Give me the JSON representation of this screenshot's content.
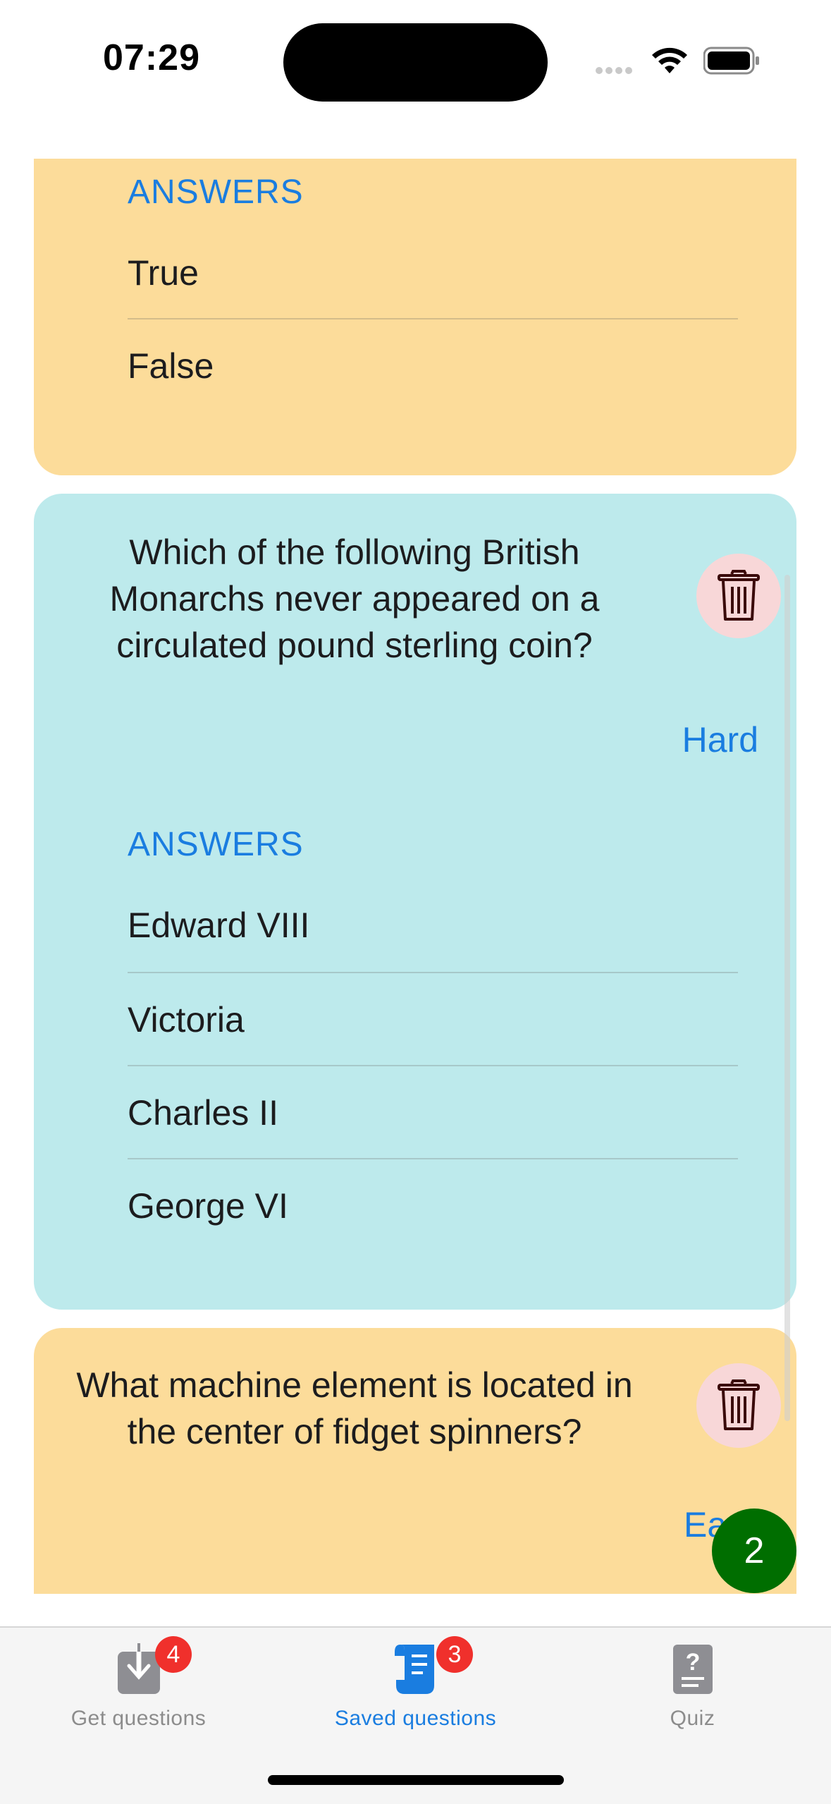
{
  "status": {
    "time": "07:29"
  },
  "cards": [
    {
      "answers_label": "ANSWERS",
      "answers": [
        "True",
        "False"
      ]
    },
    {
      "question": "Which of the following  British Monarchs never appeared on a circulated pound sterling coin?",
      "difficulty": "Hard",
      "answers_label": "ANSWERS",
      "answers": [
        "Edward VIII",
        "Victoria",
        "Charles II",
        "George VI"
      ]
    },
    {
      "question": "What machine element is located in the center of fidget spinners?",
      "difficulty": "Ea"
    }
  ],
  "fab": {
    "count": "2"
  },
  "tabs": [
    {
      "label": "Get questions",
      "badge": "4",
      "icon": "download-tray-icon",
      "active": false
    },
    {
      "label": "Saved questions",
      "badge": "3",
      "icon": "scroll-icon",
      "active": true
    },
    {
      "label": "Quiz",
      "badge": "",
      "icon": "question-doc-icon",
      "active": false
    }
  ],
  "colors": {
    "card_yellow": "#fcdc9a",
    "card_cyan": "#bdeaec",
    "accent_blue": "#1a7de0",
    "trash_bg": "#f8d7d8",
    "fab_green": "#006e00",
    "badge_red": "#f0302c"
  }
}
